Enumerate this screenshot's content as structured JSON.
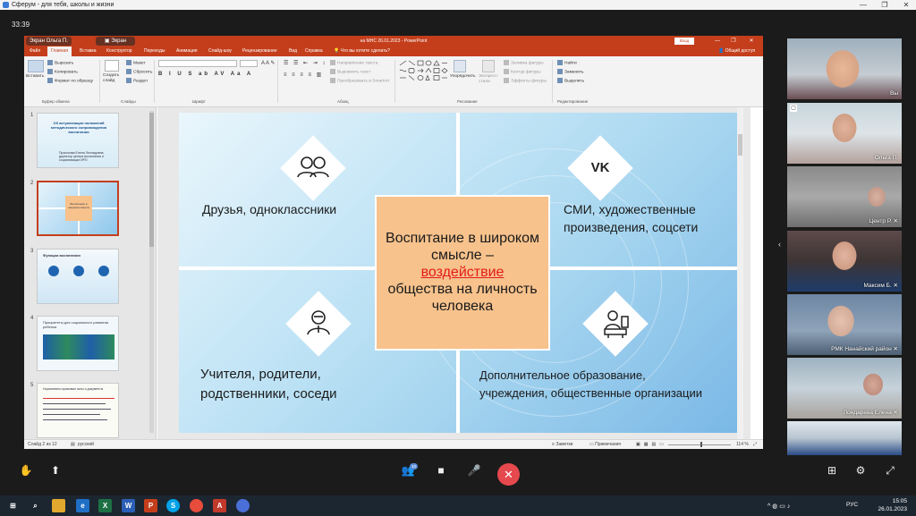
{
  "window": {
    "title": "Сферум - для тебя, школы и жизни"
  },
  "meeting": {
    "timer": "33:39"
  },
  "presentation": {
    "presenter": "Экран Ольга П.",
    "screen_label": "Экран",
    "doc_title": "на МНС  26.01.2023 - PowerPoint",
    "login": "Вход",
    "menu": [
      "Файл",
      "Главная",
      "Вставка",
      "Конструктор",
      "Переходы",
      "Анимация",
      "Слайд-шоу",
      "Рецензирование",
      "Вид",
      "Справка"
    ],
    "tell_me": "Что вы хотите сделать?",
    "share": "Общий доступ",
    "ribbon": {
      "paste": "Вставить",
      "cut": "Вырезать",
      "copy": "Копировать",
      "format_painter": "Формат по образцу",
      "clipboard": "Буфер обмена",
      "new_slide": "Создать слайд",
      "layout": "Макет",
      "reset": "Сбросить",
      "section": "Раздел",
      "slides": "Слайды",
      "font": "Шрифт",
      "text_direction": "Направление текста",
      "align_text": "Выровнять текст",
      "smartart": "Преобразовать в SmartArt",
      "paragraph": "Абзац",
      "arrange": "Упорядочить",
      "quick_styles": "Экспресс-стили",
      "shape_fill": "Заливка фигуры",
      "shape_outline": "Контур фигуры",
      "shape_effects": "Эффекты фигуры",
      "drawing": "Рисование",
      "find": "Найти",
      "replace": "Заменить",
      "select": "Выделить",
      "editing": "Редактирование"
    },
    "thumbnails": [
      {
        "num": "1",
        "text": "Об актуализации положений методического сопровождения воспитания",
        "sub": "Прокопова Елена Леонидовна, директор центра воспитания и социализации ИРО"
      },
      {
        "num": "2",
        "text": "Воспитание в широком смысле"
      },
      {
        "num": "3",
        "text": "Функции воспитания"
      },
      {
        "num": "4",
        "text": "Приоритеты для социального развития ребенка"
      },
      {
        "num": "5",
        "text": "Нормативно-правовые акты и документы"
      }
    ],
    "slide": {
      "q1": "Друзья, одноклассники",
      "q2": "СМИ, художественные произведения, соцсети",
      "q3": "Учителя, родители, родственники, соседи",
      "q4": "Дополнительное образование, учреждения, общественные организации",
      "center_1": "Воспитание в широком смысле –",
      "center_hl": "воздействие",
      "center_2": "общества на личность человека",
      "icon_vk": "VK"
    },
    "status": {
      "slide_of": "Слайд 2 из 12",
      "lang": "русский",
      "notes": "Заметки",
      "comments": "Примечания",
      "zoom": "114 %"
    }
  },
  "participants": [
    {
      "name": "Вы"
    },
    {
      "name": "Ольга П."
    },
    {
      "name": "Центр Р."
    },
    {
      "name": "Максим Б."
    },
    {
      "name": "РМК Нанайский район"
    },
    {
      "name": "Лондарева Елена"
    },
    {
      "name": ""
    }
  ],
  "controls": {
    "badge": "10"
  },
  "taskbar": {
    "time": "15:05",
    "date": "26.01.2023",
    "lang": "РУС"
  }
}
